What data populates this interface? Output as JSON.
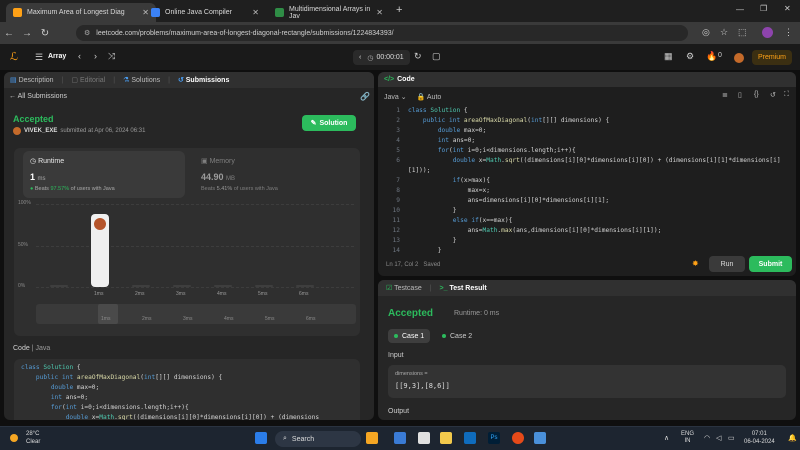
{
  "browser": {
    "tabs": [
      {
        "title": "Maximum Area of Longest Diag",
        "active": true,
        "color": "#ffa116"
      },
      {
        "title": "Online Java Compiler",
        "active": false,
        "color": "#3b82f6"
      },
      {
        "title": "Multidimensional Arrays in Jav",
        "active": false,
        "color": "#2f8d46"
      }
    ],
    "url": "leetcode.com/problems/maximum-area-of-longest-diagonal-rectangle/submissions/1224834393/"
  },
  "header": {
    "problem_list": "Array",
    "timer": "00:00:01",
    "coins": "0",
    "premium": "Premium"
  },
  "left": {
    "tabs": [
      "Description",
      "Editorial",
      "Solutions",
      "Submissions"
    ],
    "all_submissions": "All Submissions",
    "status": "Accepted",
    "user": "VIVEK_EXE",
    "submitted": "submitted at Apr 06, 2024 06:31",
    "solution_button": "Solution",
    "runtime": {
      "label": "Runtime",
      "value": "1",
      "unit": "ms",
      "beats_prefix": "Beats",
      "beats": "97.57%",
      "beats_suffix": "of users with Java"
    },
    "memory": {
      "label": "Memory",
      "value": "44.90",
      "unit": "MB",
      "beats_prefix": "Beats",
      "beats": "5.41%",
      "beats_suffix": "of users with Java"
    },
    "code_label": "Code",
    "code_lang": "Java",
    "code_lines": [
      "class Solution {",
      "    public int areaOfMaxDiagonal(int[][] dimensions) {",
      "        double max=0;",
      "        int ans=0;",
      "        for(int i=0;i<dimensions.length;i++){",
      "            double x=Math.sqrt((dimensions[i][0]*dimensions[i][0]) + (dimensions"
    ]
  },
  "chart_data": {
    "type": "bar",
    "categories": [
      "",
      "1ms",
      "2ms",
      "3ms",
      "4ms",
      "5ms",
      "6ms"
    ],
    "values": [
      2,
      88,
      1,
      1,
      1,
      1,
      1
    ],
    "highlight_index": 1,
    "yticks": [
      "100%",
      "50%",
      "0%"
    ],
    "ylim": [
      0,
      100
    ],
    "minimap_labels": [
      "1ms",
      "2ms",
      "3ms",
      "4ms",
      "5ms",
      "6ms"
    ]
  },
  "editor": {
    "title": "Code",
    "language": "Java",
    "autosave": "Auto",
    "status": "Ln 17, Col 2",
    "saved": "Saved",
    "lines": [
      {
        "n": "1",
        "t": "class Solution {"
      },
      {
        "n": "2",
        "t": "    public int areaOfMaxDiagonal(int[][] dimensions) {"
      },
      {
        "n": "3",
        "t": "        double max=0;"
      },
      {
        "n": "4",
        "t": "        int ans=0;"
      },
      {
        "n": "5",
        "t": "        for(int i=0;i<dimensions.length;i++){"
      },
      {
        "n": "6",
        "t": "            double x=Math.sqrt((dimensions[i][0]*dimensions[i][0]) + (dimensions[i][1]*dimensions[i]"
      },
      {
        "n": "",
        "t": "[1]));"
      },
      {
        "n": "7",
        "t": "            if(x>max){"
      },
      {
        "n": "8",
        "t": "                max=x;"
      },
      {
        "n": "9",
        "t": "                ans=dimensions[i][0]*dimensions[i][1];"
      },
      {
        "n": "10",
        "t": "            }"
      },
      {
        "n": "11",
        "t": "            else if(x==max){"
      },
      {
        "n": "12",
        "t": "                ans=Math.max(ans,dimensions[i][0]*dimensions[i][1]);"
      },
      {
        "n": "13",
        "t": "            }"
      },
      {
        "n": "14",
        "t": "        }"
      }
    ],
    "run": "Run",
    "submit": "Submit"
  },
  "test": {
    "tabs": [
      "Testcase",
      "Test Result"
    ],
    "status": "Accepted",
    "runtime": "Runtime: 0 ms",
    "cases": [
      "Case 1",
      "Case 2"
    ],
    "input_label": "Input",
    "param_name": "dimensions =",
    "param_value": "[[9,3],[8,6]]",
    "output_label": "Output"
  },
  "taskbar": {
    "temp": "28°C",
    "weather": "Clear",
    "search": "Search",
    "lang": "ENG",
    "region": "IN",
    "time": "07:01",
    "date": "06-04-2024"
  }
}
